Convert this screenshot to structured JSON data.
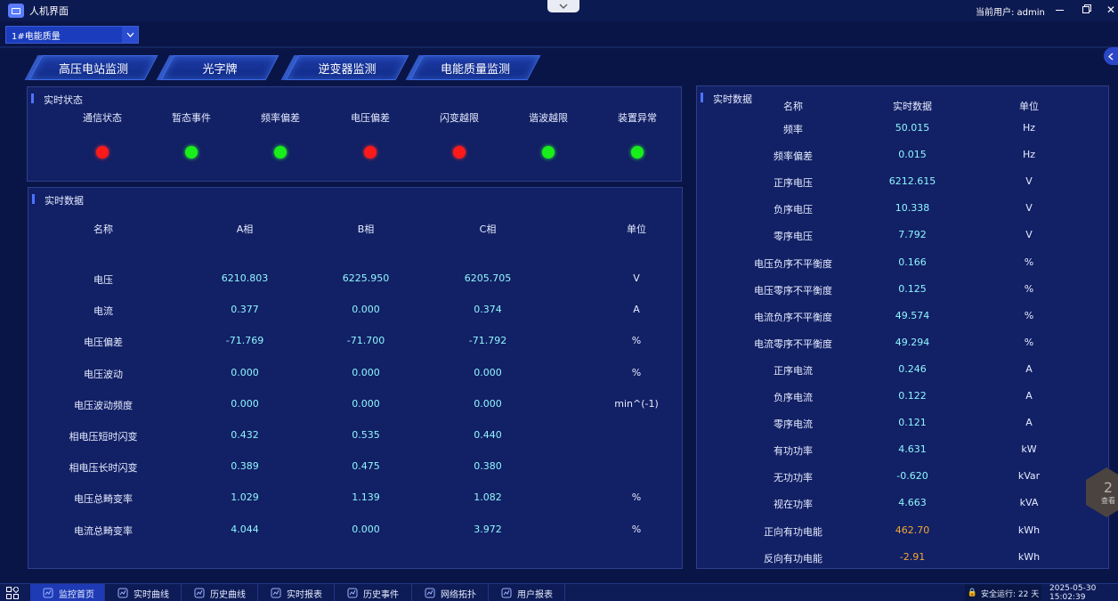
{
  "app": {
    "title": "人机界面"
  },
  "user": {
    "label": "当前用户: admin"
  },
  "device_select": {
    "value": "1#电能质量"
  },
  "tabs": [
    {
      "label": "高压电站监测"
    },
    {
      "label": "光字牌"
    },
    {
      "label": "逆变器监测"
    },
    {
      "label": "电能质量监测"
    }
  ],
  "status_panel": {
    "title": "实时状态",
    "items": [
      {
        "label": "通信状态",
        "state": "red"
      },
      {
        "label": "暂态事件",
        "state": "green"
      },
      {
        "label": "频率偏差",
        "state": "green"
      },
      {
        "label": "电压偏差",
        "state": "red"
      },
      {
        "label": "闪变越限",
        "state": "red"
      },
      {
        "label": "谐波越限",
        "state": "green"
      },
      {
        "label": "装置异常",
        "state": "green"
      }
    ]
  },
  "phase_panel": {
    "title": "实时数据",
    "headers": [
      "名称",
      "A相",
      "B相",
      "C相",
      "单位"
    ],
    "rows": [
      [
        "电压",
        "6210.803",
        "6225.950",
        "6205.705",
        "V"
      ],
      [
        "电流",
        "0.377",
        "0.000",
        "0.374",
        "A"
      ],
      [
        "电压偏差",
        "-71.769",
        "-71.700",
        "-71.792",
        "%"
      ],
      [
        "电压波动",
        "0.000",
        "0.000",
        "0.000",
        "%"
      ],
      [
        "电压波动频度",
        "0.000",
        "0.000",
        "0.000",
        "min^(-1)"
      ],
      [
        "相电压短时闪变",
        "0.432",
        "0.535",
        "0.440",
        ""
      ],
      [
        "相电压长时闪变",
        "0.389",
        "0.475",
        "0.380",
        ""
      ],
      [
        "电压总畸变率",
        "1.029",
        "1.139",
        "1.082",
        "%"
      ],
      [
        "电流总畸变率",
        "4.044",
        "0.000",
        "3.972",
        "%"
      ]
    ]
  },
  "right_panel": {
    "title": "实时数据",
    "headers": [
      "名称",
      "实时数据",
      "单位"
    ],
    "rows": [
      [
        "频率",
        "50.015",
        "Hz"
      ],
      [
        "频率偏差",
        "0.015",
        "Hz"
      ],
      [
        "正序电压",
        "6212.615",
        "V"
      ],
      [
        "负序电压",
        "10.338",
        "V"
      ],
      [
        "零序电压",
        "7.792",
        "V"
      ],
      [
        "电压负序不平衡度",
        "0.166",
        "%"
      ],
      [
        "电压零序不平衡度",
        "0.125",
        "%"
      ],
      [
        "电流负序不平衡度",
        "49.574",
        "%"
      ],
      [
        "电流零序不平衡度",
        "49.294",
        "%"
      ],
      [
        "正序电流",
        "0.246",
        "A"
      ],
      [
        "负序电流",
        "0.122",
        "A"
      ],
      [
        "零序电流",
        "0.121",
        "A"
      ],
      [
        "有功功率",
        "4.631",
        "kW"
      ],
      [
        "无功功率",
        "-0.620",
        "kVar"
      ],
      [
        "视在功率",
        "4.663",
        "kVA"
      ],
      [
        "正向有功电能",
        "462.70",
        "kWh"
      ],
      [
        "反向有功电能",
        "-2.91",
        "kWh"
      ]
    ]
  },
  "hex_badge": {
    "num": "2",
    "text": "查看"
  },
  "bottom_nav": [
    {
      "label": "监控首页",
      "icon": "home-icon",
      "active": true
    },
    {
      "label": "实时曲线",
      "icon": "trend-icon"
    },
    {
      "label": "历史曲线",
      "icon": "history-curve-icon"
    },
    {
      "label": "实时报表",
      "icon": "report-icon"
    },
    {
      "label": "历史事件",
      "icon": "event-icon"
    },
    {
      "label": "网络拓扑",
      "icon": "topology-icon"
    },
    {
      "label": "用户报表",
      "icon": "user-report-icon"
    }
  ],
  "footer": {
    "safe_run": "安全运行: 22 天",
    "datetime": "2025-05-30 15:02:39"
  },
  "colors": {
    "red": "#ff1a1a",
    "green": "#18ef1a",
    "value": "#8ff7ff",
    "energy": "#f2a733"
  }
}
